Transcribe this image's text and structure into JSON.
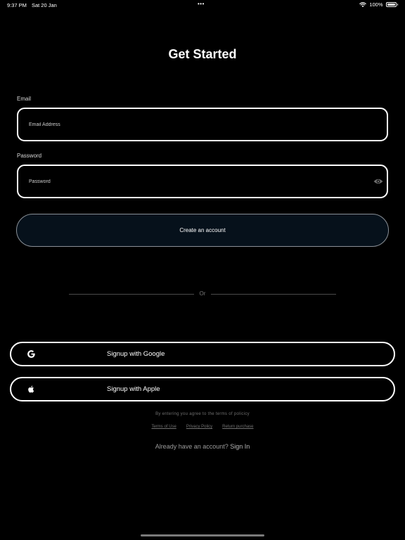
{
  "status_bar": {
    "time": "9:37 PM",
    "date": "Sat 20 Jan",
    "dots": "•••",
    "battery": "100%",
    "wifi_icon": "wifi-icon",
    "battery_icon": "battery-icon"
  },
  "title": "Get Started",
  "email": {
    "label": "Email",
    "placeholder": "Email Address",
    "value": ""
  },
  "password": {
    "label": "Password",
    "placeholder": "Password",
    "value": "",
    "toggle_icon": "eye-icon"
  },
  "create_account_label": "Create an account",
  "divider_text": "Or",
  "google": {
    "label": "Signup with Google",
    "icon": "google-icon"
  },
  "apple": {
    "label": "Signup with Apple",
    "icon": "apple-icon"
  },
  "policy_text": "By entering you agree to the terms of policicy",
  "links": {
    "terms": "Terms of Use",
    "privacy": "Privacy Policy",
    "return": "Return purchase"
  },
  "signin": {
    "prompt": "Already have an account?",
    "link": "Sign In"
  },
  "colors": {
    "background": "#000000",
    "text": "#ffffff",
    "button_fill": "#06111b",
    "muted_text": "#707070"
  }
}
